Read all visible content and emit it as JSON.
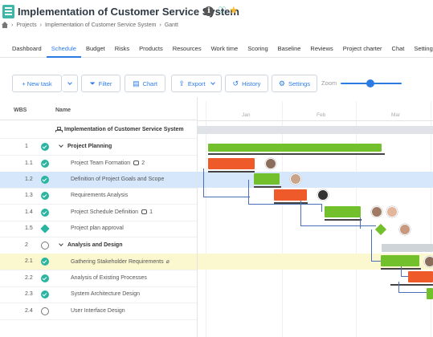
{
  "header": {
    "title": "Implementation of Customer Service System",
    "icons": {
      "info": "info-icon",
      "heart": "heart-icon",
      "star": "star-icon"
    }
  },
  "breadcrumb": {
    "items": [
      "Projects",
      "Implementation of Customer Service System",
      "Gantt"
    ],
    "separator": "›"
  },
  "nav": {
    "tabs": [
      "Dashboard",
      "Schedule",
      "Budget",
      "Risks",
      "Products",
      "Resources",
      "Work time",
      "Scoring",
      "Baseline",
      "Reviews",
      "Project charter",
      "Chat",
      "Settings"
    ],
    "active": "Schedule"
  },
  "toolbar": {
    "new_task": "+ New task",
    "filter": "Filter",
    "chart": "Chart",
    "export": "Export",
    "history": "History",
    "settings": "Settings",
    "zoom_label": "Zoom",
    "zoom_level": 0.43
  },
  "grid": {
    "headers": {
      "wbs": "WBS",
      "name": "Name"
    },
    "root": "Implementation of Customer Service System",
    "rows": [
      {
        "wbs": "1",
        "name": "Project Planning",
        "type": "summary",
        "status": "done"
      },
      {
        "wbs": "1.1",
        "name": "Project Team Formation",
        "comments": "2",
        "status": "done"
      },
      {
        "wbs": "1.2",
        "name": "Definition of Project Goals and Scope",
        "status": "done",
        "selected": true
      },
      {
        "wbs": "1.3",
        "name": "Requirements Analysis",
        "status": "done"
      },
      {
        "wbs": "1.4",
        "name": "Project Schedule Definition",
        "comments": "1",
        "status": "done"
      },
      {
        "wbs": "1.5",
        "name": "Project plan approval",
        "status": "milestone"
      },
      {
        "wbs": "2",
        "name": "Analysis and Design",
        "type": "summary",
        "status": "open"
      },
      {
        "wbs": "2.1",
        "name": "Gathering Stakeholder Requirements",
        "attachment": true,
        "status": "done",
        "highlighted": true
      },
      {
        "wbs": "2.2",
        "name": "Analysis of Existing Processes",
        "status": "done"
      },
      {
        "wbs": "2.3",
        "name": "System Architecture Design",
        "status": "done"
      },
      {
        "wbs": "2.4",
        "name": "User Interface Design",
        "status": "open"
      }
    ]
  },
  "gantt": {
    "months": [
      "Jan",
      "Feb",
      "Mar"
    ]
  },
  "colors": {
    "accent": "#2c7be5",
    "done": "#2bb5a0",
    "bar_green": "#72c02c",
    "bar_red": "#ef5a2a",
    "selected_row": "#d7e7fb",
    "highlight_row": "#fbf7cf"
  }
}
